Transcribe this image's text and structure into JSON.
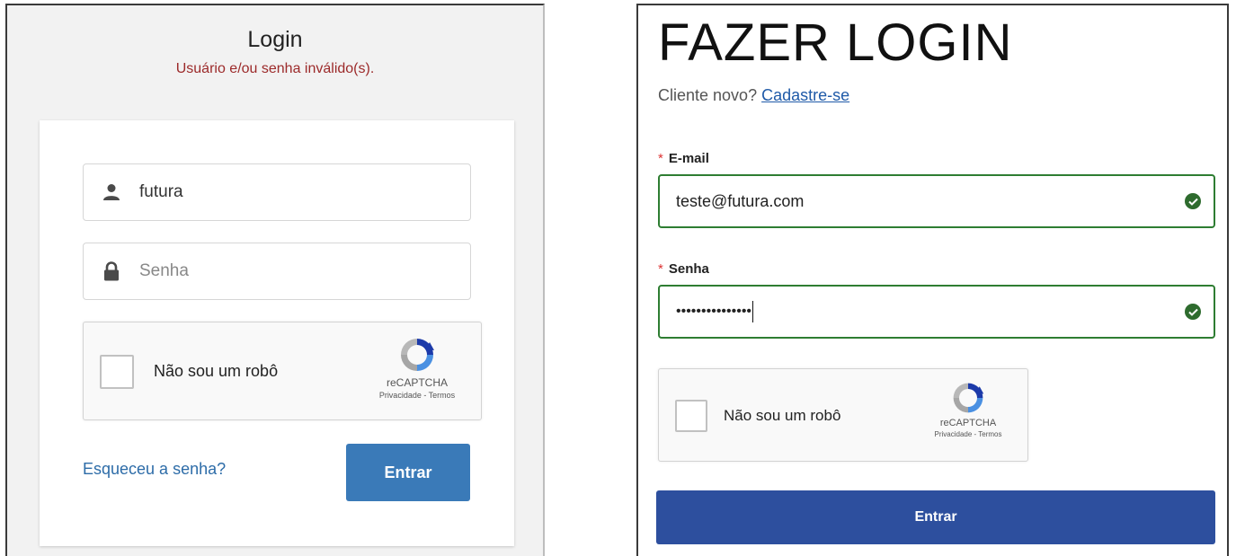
{
  "left": {
    "title": "Login",
    "error": "Usuário e/ou senha inválido(s).",
    "username_value": "futura",
    "password_placeholder": "Senha",
    "captcha": {
      "label": "Não sou um robô",
      "brand": "reCAPTCHA",
      "links": "Privacidade - Termos"
    },
    "forgot_label": "Esqueceu a senha?",
    "submit_label": "Entrar",
    "icons": {
      "user": "user-icon",
      "lock": "lock-icon"
    },
    "colors": {
      "error": "#9c2a2a",
      "link": "#2d6ca8",
      "button": "#3a7ab8"
    }
  },
  "right": {
    "title": "FAZER LOGIN",
    "subtitle_prefix": "Cliente novo?",
    "register_link": "Cadastre-se",
    "email_label": "E-mail",
    "email_value": "teste@futura.com",
    "password_label": "Senha",
    "password_value": "•••••••••••••••",
    "required_mark": "*",
    "captcha": {
      "label": "Não sou um robô",
      "brand": "reCAPTCHA",
      "links": "Privacidade - Termos"
    },
    "submit_label": "Entrar",
    "icons": {
      "valid": "check-circle-icon"
    },
    "colors": {
      "valid_border": "#2e7d32",
      "button": "#2d4f9e",
      "link": "#1f5aa8"
    }
  }
}
